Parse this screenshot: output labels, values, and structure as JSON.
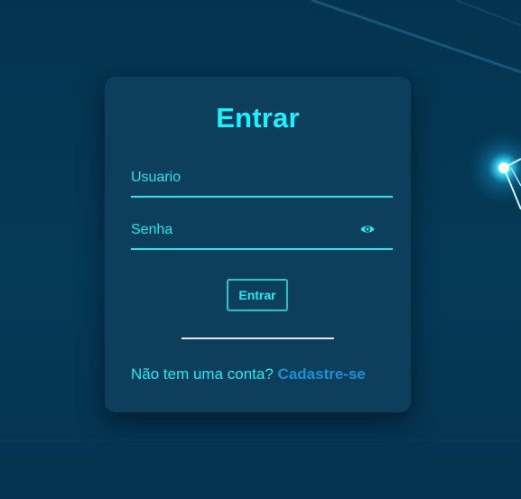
{
  "login_form": {
    "title": "Entrar",
    "username_placeholder": "Usuario",
    "password_placeholder": "Senha",
    "password_toggle_icon": "eye-icon",
    "submit_label": "Entrar",
    "signup_prompt": "Não tem uma conta?",
    "signup_link": "Cadastre-se"
  },
  "colors": {
    "background": "#04354f",
    "card": "#0d3f5d",
    "accent_cyan": "#1fe6f0",
    "link_blue": "#1a8fd6",
    "divider": "#dfe9ee"
  }
}
